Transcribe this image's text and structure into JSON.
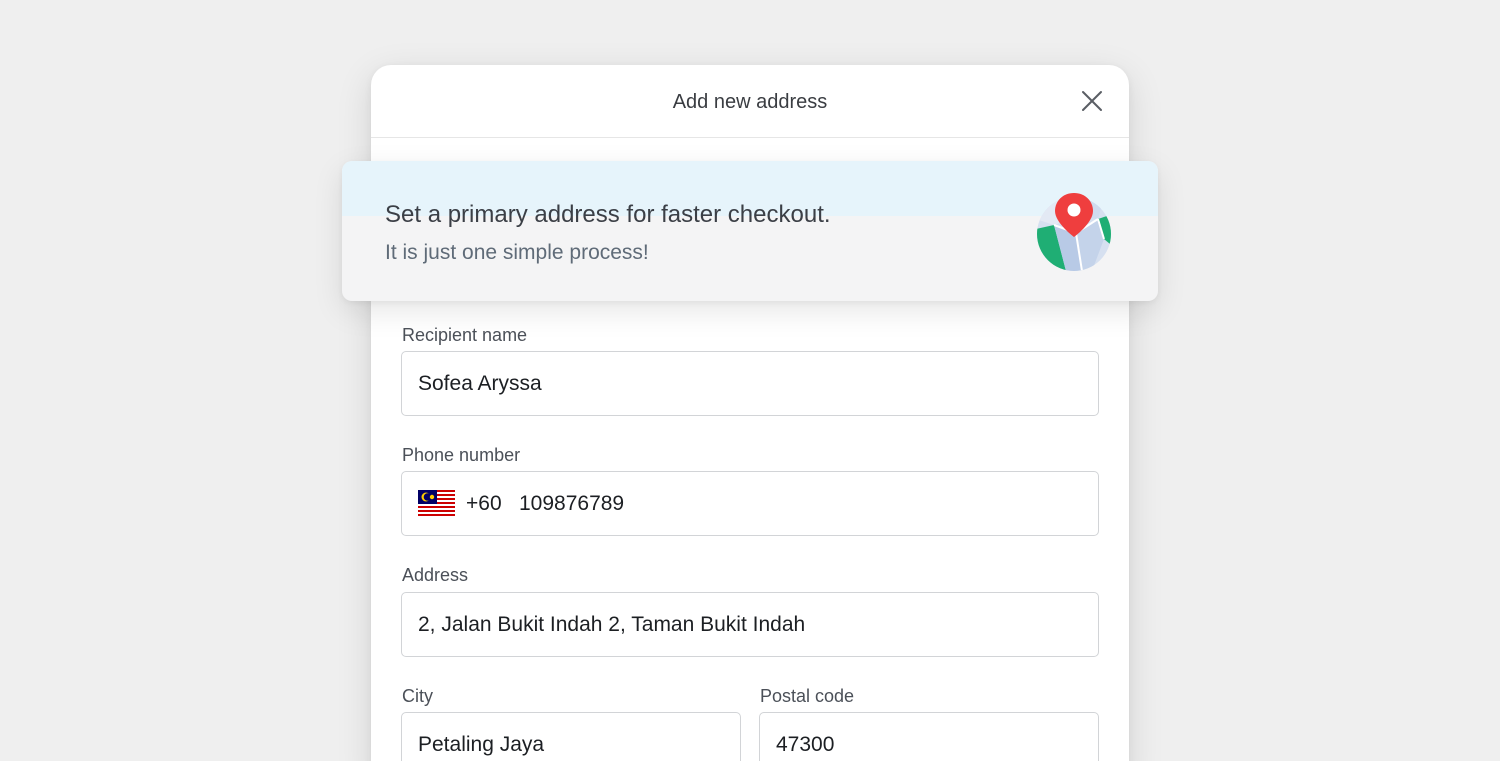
{
  "modal": {
    "title": "Add new address",
    "close_icon": "close-icon"
  },
  "banner": {
    "title": "Set a primary address for faster checkout.",
    "subtitle": "It is just one simple process!",
    "illustration_icon": "map-pin-icon"
  },
  "form": {
    "recipient": {
      "label": "Recipient name",
      "value": "Sofea Aryssa"
    },
    "phone": {
      "label": "Phone number",
      "flag_icon": "malaysia-flag-icon",
      "dial_code": "+60",
      "value": "109876789"
    },
    "address": {
      "label": "Address",
      "value": "2, Jalan Bukit Indah 2, Taman Bukit Indah"
    },
    "city": {
      "label": "City",
      "value": "Petaling Jaya"
    },
    "postal_code": {
      "label": "Postal code",
      "value": "47300"
    }
  },
  "colors": {
    "background": "#efefef",
    "banner_tint": "#e6f4fb",
    "pin_red": "#ef3e3e",
    "map_green": "#1fae74",
    "map_blue": "#b8cae6"
  }
}
